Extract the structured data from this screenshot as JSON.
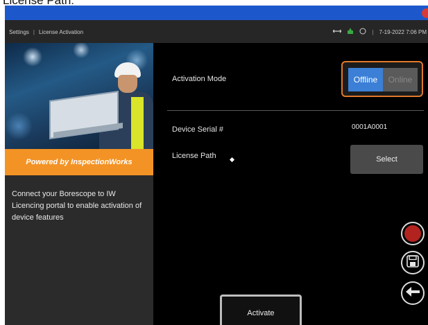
{
  "document_caption": "License Path:",
  "status_bar": {
    "breadcrumb": [
      "Settings",
      "License Activation"
    ],
    "separator": "|",
    "datetime": "7-19-2022 7:06 PM"
  },
  "left_panel": {
    "brand_text": "Powered by InspectionWorks",
    "description": "Connect your Borescope to IW Licencing portal to enable activation of device features"
  },
  "form": {
    "activation_mode_label": "Activation Mode",
    "mode_options": [
      "Offline",
      "Online"
    ],
    "selected_mode": "Offline",
    "device_serial_label": "Device Serial #",
    "device_serial_value": "0001A0001",
    "license_path_label": "License Path",
    "select_button_label": "Select",
    "activate_button_label": "Activate"
  },
  "icons": {
    "status": [
      "usb-icon",
      "battery-charging-icon",
      "wifi-icon"
    ],
    "actions": [
      "record-icon",
      "save-icon",
      "back-arrow-icon"
    ]
  },
  "colors": {
    "accent_blue": "#1c58cc",
    "brand_orange": "#f39325",
    "toggle_border": "#e2792b",
    "selected_segment": "#3b7fd6",
    "record_red": "#b2231f"
  }
}
